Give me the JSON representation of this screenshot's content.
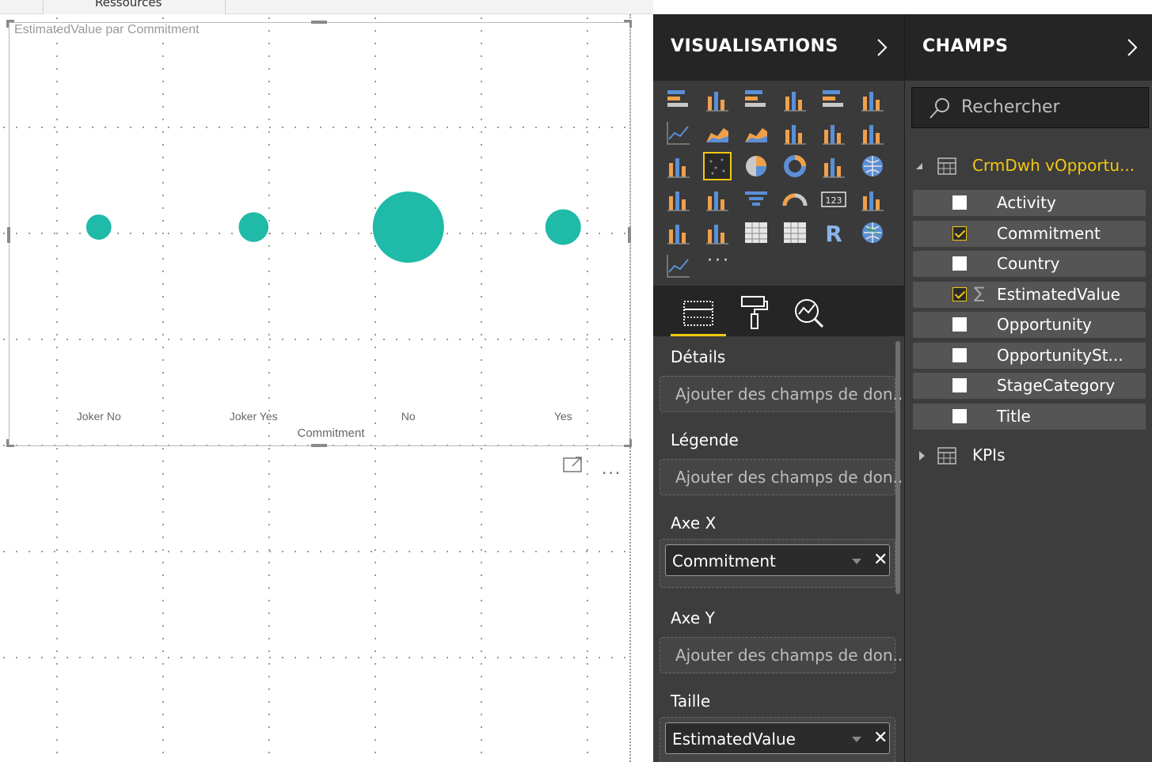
{
  "ribbon": {
    "tab_label": "Ressources"
  },
  "visual": {
    "title": "EstimatedValue par Commitment",
    "more_label": "···"
  },
  "chart_data": {
    "type": "scatter",
    "title": "EstimatedValue par Commitment",
    "xlabel": "Commitment",
    "ylabel": "",
    "categories": [
      "Joker No",
      "Joker Yes",
      "No",
      "Yes"
    ],
    "size_field": "EstimatedValue",
    "sizes": [
      1.0,
      1.4,
      8.0,
      2.0
    ],
    "color": "#1fbaa8"
  },
  "visualizations": {
    "title": "VISUALISATIONS",
    "more_label": "···",
    "icons": [
      "stacked-bar",
      "stacked-column",
      "clustered-bar",
      "clustered-column",
      "100-stacked-bar",
      "100-stacked-column",
      "line",
      "area",
      "stacked-area",
      "line-clustered-column",
      "line-stacked-column",
      "ribbon",
      "waterfall",
      "scatter",
      "pie",
      "donut",
      "treemap",
      "map",
      "filled-map",
      "shape-map",
      "funnel",
      "gauge",
      "card",
      "multirow-card",
      "kpi",
      "slicer",
      "table",
      "matrix",
      "r-visual",
      "arcgis-map",
      "custom-visual"
    ],
    "selected_icon": "scatter",
    "tabs": [
      "fields-tab",
      "format-tab",
      "analytics-tab"
    ],
    "wells": {
      "details": {
        "label": "Détails",
        "placeholder": "Ajouter des champs de don..."
      },
      "legend": {
        "label": "Légende",
        "placeholder": "Ajouter des champs de don..."
      },
      "axis_x": {
        "label": "Axe X",
        "value": "Commitment"
      },
      "axis_y": {
        "label": "Axe Y",
        "placeholder": "Ajouter des champs de don..."
      },
      "size": {
        "label": "Taille",
        "value": "EstimatedValue"
      }
    }
  },
  "fields": {
    "title": "CHAMPS",
    "search_placeholder": "Rechercher",
    "tables": [
      {
        "name": "CrmDwh vOpportu...",
        "expanded": true,
        "color": "#f2c811"
      },
      {
        "name": "KPIs",
        "expanded": false,
        "color": "#ffffff"
      }
    ],
    "items": [
      {
        "name": "Activity",
        "checked": false,
        "sigma": false
      },
      {
        "name": "Commitment",
        "checked": true,
        "sigma": false
      },
      {
        "name": "Country",
        "checked": false,
        "sigma": false
      },
      {
        "name": "EstimatedValue",
        "checked": true,
        "sigma": true
      },
      {
        "name": "Opportunity",
        "checked": false,
        "sigma": false
      },
      {
        "name": "OpportunitySt...",
        "checked": false,
        "sigma": false
      },
      {
        "name": "StageCategory",
        "checked": false,
        "sigma": false
      },
      {
        "name": "Title",
        "checked": false,
        "sigma": false
      }
    ]
  },
  "colors": {
    "accent": "#f2c811",
    "bubble": "#1fbaa8",
    "pane_bg": "#3d3d3d",
    "header_bg": "#252525"
  }
}
